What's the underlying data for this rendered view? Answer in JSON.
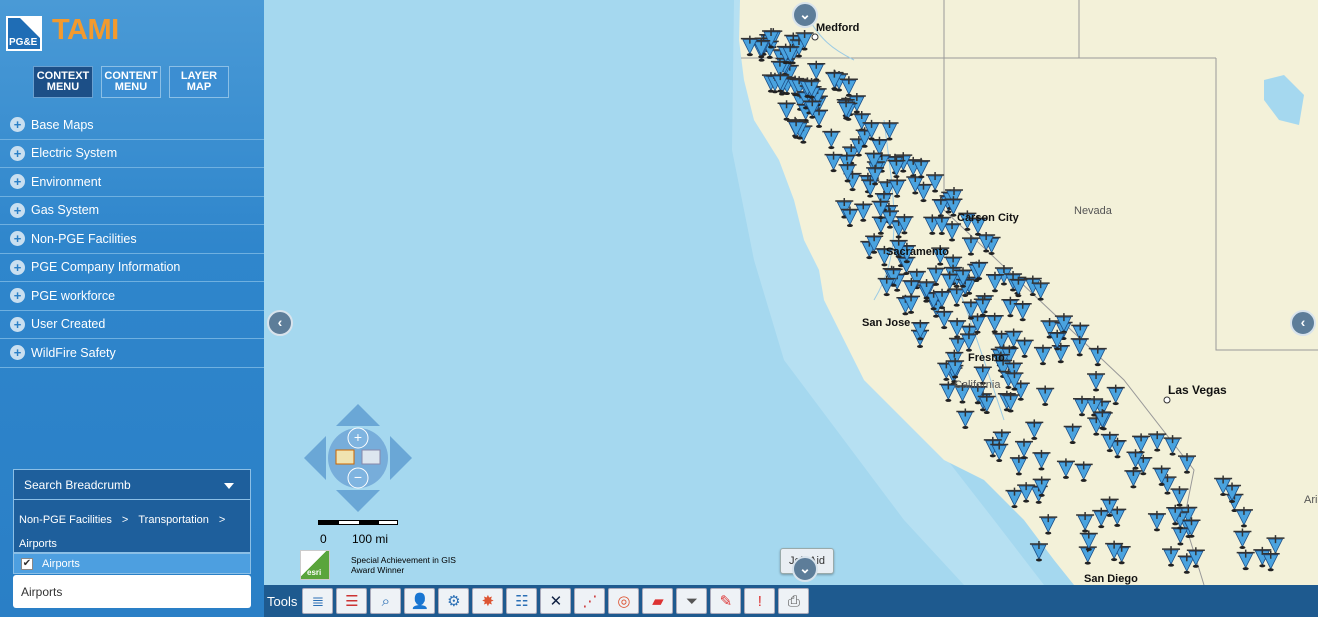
{
  "app": {
    "title": "TAMI",
    "logo_text": "PG&E"
  },
  "top_menu": [
    {
      "label": "CONTEXT\nMENU",
      "line1": "CONTEXT",
      "line2": "MENU"
    },
    {
      "line1": "CONTENT",
      "line2": "MENU"
    },
    {
      "line1": "LAYER",
      "line2": "MAP"
    }
  ],
  "layers": [
    {
      "label": "Base Maps"
    },
    {
      "label": "Electric System"
    },
    {
      "label": "Environment"
    },
    {
      "label": "Gas System"
    },
    {
      "label": "Non-PGE Facilities"
    },
    {
      "label": "PGE Company Information"
    },
    {
      "label": "PGE workforce"
    },
    {
      "label": "User Created"
    },
    {
      "label": "WildFire Safety"
    }
  ],
  "breadcrumb": {
    "header": "Search Breadcrumb",
    "path": [
      "Non-PGE Facilities",
      "Transportation",
      "Airports"
    ],
    "separator": ">"
  },
  "checked_layer": {
    "label": "Airports",
    "checked": true
  },
  "search_result": "Airports",
  "map": {
    "city_labels": [
      "Medford",
      "Carson City",
      "Sacramento",
      "San Jose",
      "Fresno",
      "California",
      "Las Vegas",
      "San Diego"
    ],
    "state_labels": [
      "Nevada",
      "Ari"
    ],
    "scale": {
      "left": "0",
      "right": "100 mi"
    },
    "award": {
      "line1": "Special Achievement in GIS",
      "line2": "Award Winner"
    },
    "job_aid": "Job Aid",
    "colors": {
      "ocean": "#a5d8ef",
      "land": "#f3f1d9",
      "marker": "#4aa3df"
    }
  },
  "toolbar": {
    "label": "Tools",
    "tools": [
      "layers-tool-icon",
      "legend-tool-icon",
      "search-tool-icon",
      "user-tool-icon",
      "network-tool-icon",
      "heatmap-tool-icon",
      "database-tool-icon",
      "measure-tool-icon",
      "draw-tool-icon",
      "buffer-tool-icon",
      "selection-tool-icon",
      "filter-tool-icon",
      "markup-tool-icon",
      "alert-tool-icon",
      "print-tool-icon"
    ]
  }
}
